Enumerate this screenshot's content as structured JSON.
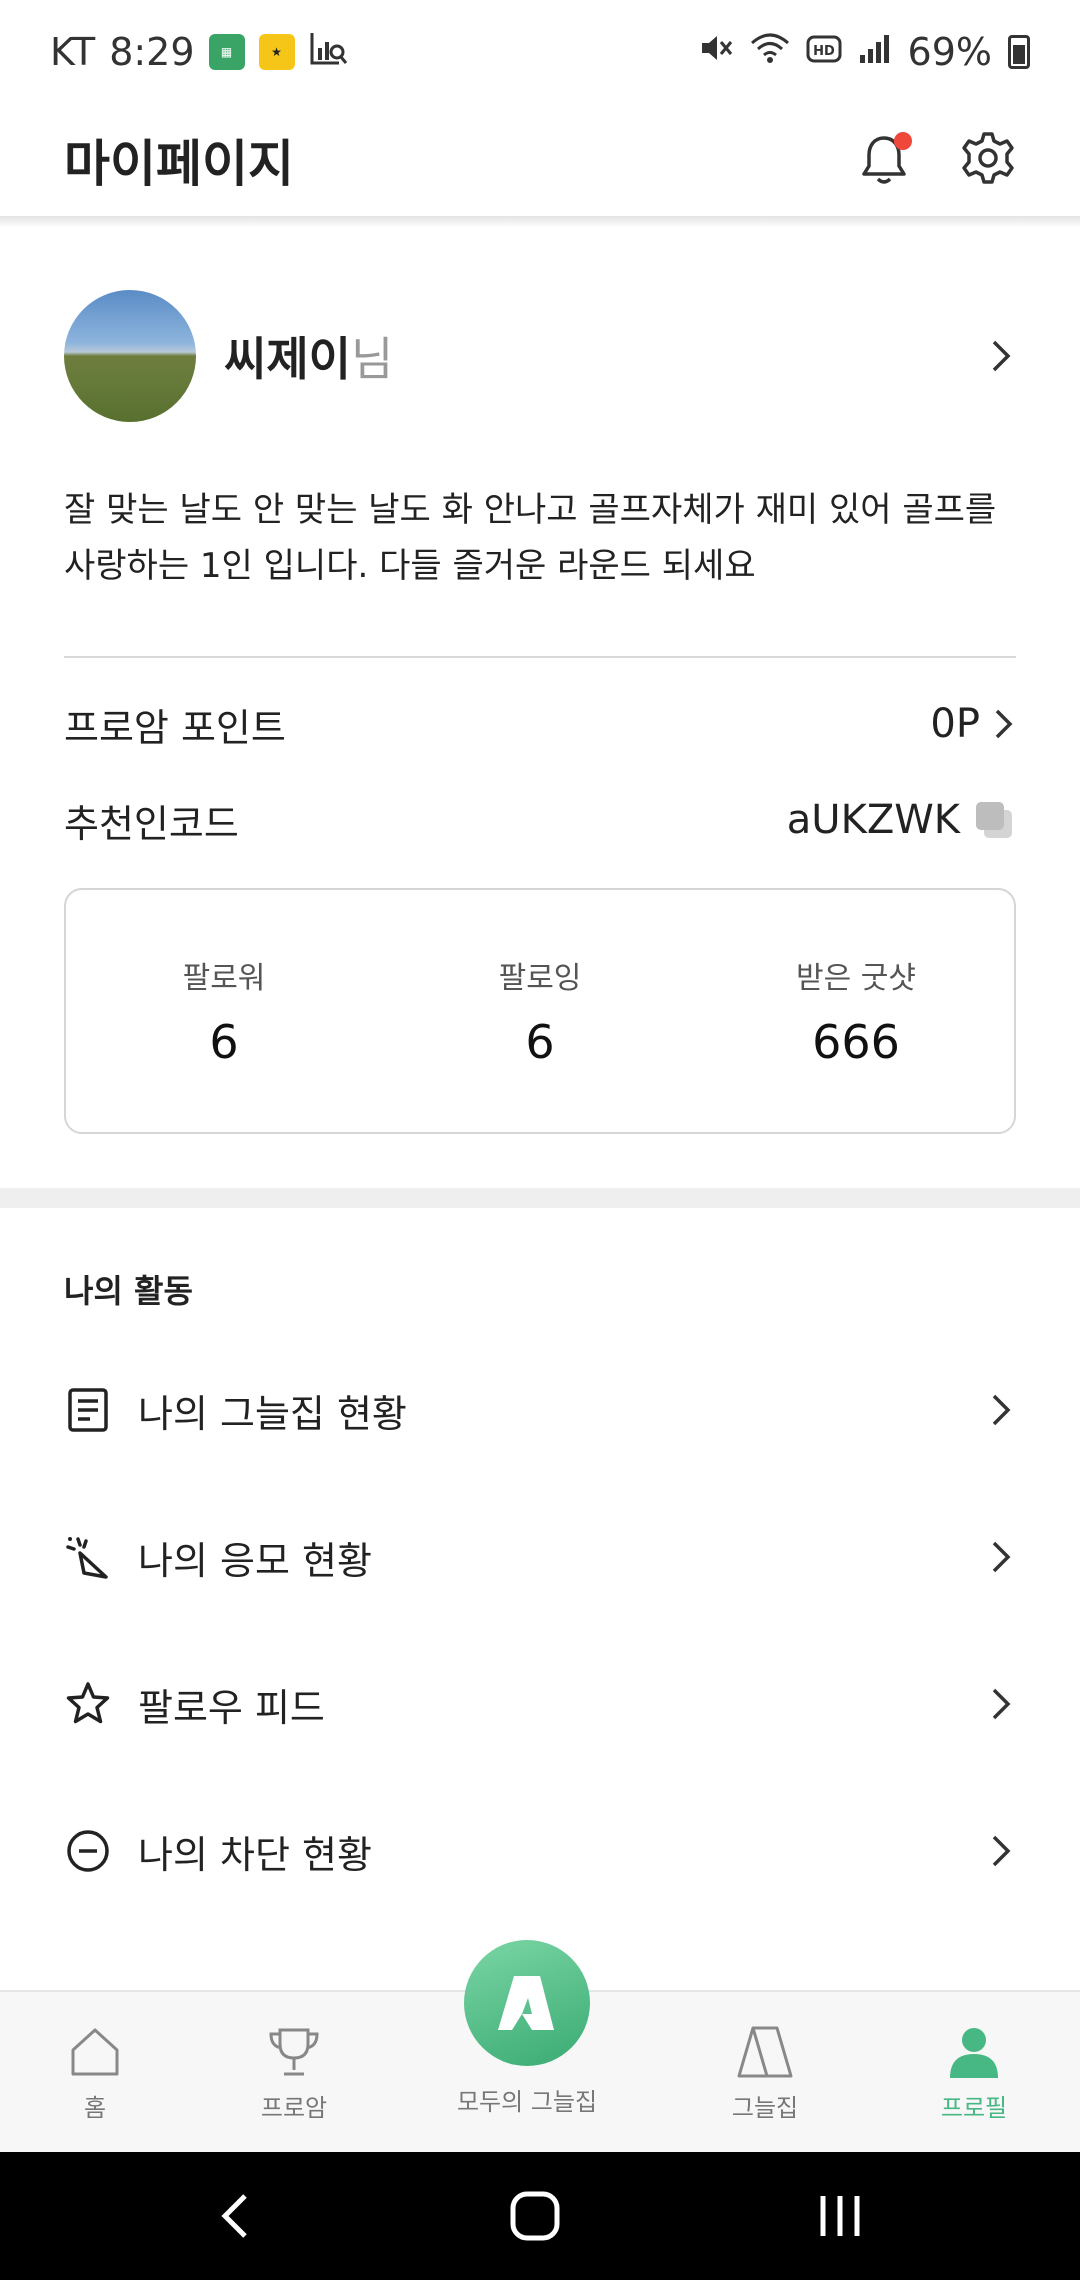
{
  "status_bar": {
    "carrier": "KT",
    "time": "8:29",
    "battery": "69%"
  },
  "header": {
    "title": "마이페이지"
  },
  "profile": {
    "name": "씨제이",
    "suffix": "님",
    "bio_line1": "잘 맞는 날도 안 맞는 날도 화 안나고 골프자체가 재미 있어 골프를",
    "bio_line2": "사랑하는 1인 입니다. 다들 즐거운 라운드 되세요"
  },
  "points": {
    "label": "프로암 포인트",
    "value": "0P"
  },
  "referral": {
    "label": "추천인코드",
    "value": "aUKZWK"
  },
  "stats": [
    {
      "label": "팔로워",
      "value": "6"
    },
    {
      "label": "팔로잉",
      "value": "6"
    },
    {
      "label": "받은 굿샷",
      "value": "666"
    }
  ],
  "activity": {
    "section_title": "나의 활동",
    "items": [
      {
        "label": "나의 그늘집 현황",
        "icon": "document-icon"
      },
      {
        "label": "나의 응모 현황",
        "icon": "party-popper-icon"
      },
      {
        "label": "팔로우 피드",
        "icon": "star-icon"
      },
      {
        "label": "나의 차단 현황",
        "icon": "block-icon"
      }
    ]
  },
  "bottom_nav": {
    "items": [
      {
        "label": "홈",
        "icon": "home-icon",
        "active": false
      },
      {
        "label": "프로암",
        "icon": "trophy-icon",
        "active": false
      },
      {
        "label": "모두의 그늘집",
        "icon": "app-logo-icon",
        "active": false
      },
      {
        "label": "그늘집",
        "icon": "tent-icon",
        "active": false
      },
      {
        "label": "프로필",
        "icon": "profile-icon",
        "active": true
      }
    ]
  },
  "colors": {
    "accent": "#47b883",
    "notification_dot": "#f0473b"
  }
}
